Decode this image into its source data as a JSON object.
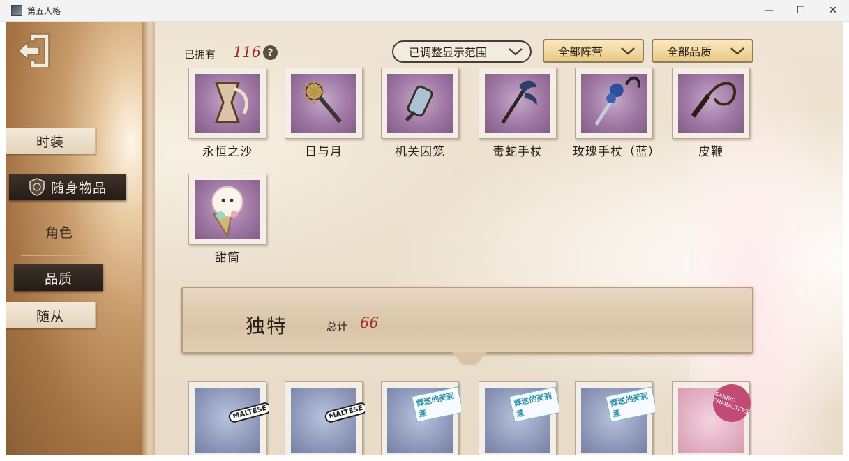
{
  "window": {
    "title": "第五人格",
    "controls": {
      "minimize": "—",
      "maximize": "☐",
      "close": "✕"
    }
  },
  "sidebar": {
    "items": [
      {
        "label": "时装"
      },
      {
        "label": "随身物品"
      },
      {
        "label": "角色"
      },
      {
        "label": "品质"
      },
      {
        "label": "随从"
      }
    ]
  },
  "header": {
    "owned_label": "已拥有",
    "owned_count": "116",
    "help": "?"
  },
  "filters": {
    "range": "已调整显示范围",
    "camp": "全部阵营",
    "quality": "全部品质"
  },
  "items": [
    {
      "name": "永恒之沙"
    },
    {
      "name": "日与月"
    },
    {
      "name": "机关囚笼"
    },
    {
      "name": "毒蛇手杖"
    },
    {
      "name": "玫瑰手杖（蓝）"
    },
    {
      "name": "皮鞭"
    },
    {
      "name": "甜筒"
    }
  ],
  "section": {
    "title": "独特",
    "total_label": "总计",
    "total": "66"
  },
  "bottom_stickers": [
    "MALTESE",
    "MALTESE",
    "葬送的芙莉莲",
    "葬送的芙莉莲",
    "葬送的芙莉莲",
    "SANRIO CHARACTERS"
  ],
  "colors": {
    "accent_red": "#9e2c25",
    "dark_tab": "#2b211a",
    "gold_dropdown": "#f0d59b",
    "stamp_purple": "#9f78a4",
    "stamp_blue": "#8f99bb"
  }
}
